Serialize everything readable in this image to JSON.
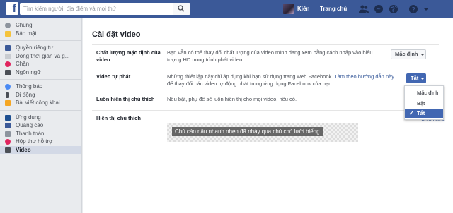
{
  "topbar": {
    "logo": "f",
    "search_placeholder": "Tìm kiếm người, địa điểm và mọi thứ",
    "user_name": "Kiên",
    "home_label": "Trang chủ"
  },
  "sidebar": {
    "groups": [
      [
        {
          "label": "Chung",
          "icon": "gear-icon",
          "color": "#8d949e"
        },
        {
          "label": "Bảo mật",
          "icon": "shield-icon",
          "color": "#f5c33b"
        }
      ],
      [
        {
          "label": "Quyền riêng tư",
          "icon": "lock-people-icon",
          "color": "#3b5998"
        },
        {
          "label": "Dòng thời gian và g...",
          "icon": "timeline-icon",
          "color": "#8d949e"
        },
        {
          "label": "Chặn",
          "icon": "block-icon",
          "color": "#e0245e"
        },
        {
          "label": "Ngôn ngữ",
          "icon": "language-icon",
          "color": "#4b4f56"
        }
      ],
      [
        {
          "label": "Thông báo",
          "icon": "globe-icon",
          "color": "#4a8af4"
        },
        {
          "label": "Di động",
          "icon": "mobile-icon",
          "color": "#4b4f56"
        },
        {
          "label": "Bài viết công khai",
          "icon": "rss-icon",
          "color": "#f5a623"
        }
      ],
      [
        {
          "label": "Ứng dụng",
          "icon": "apps-icon",
          "color": "#1d4f91"
        },
        {
          "label": "Quảng cáo",
          "icon": "ads-icon",
          "color": "#3b5998"
        },
        {
          "label": "Thanh toán",
          "icon": "card-icon",
          "color": "#8d949e"
        },
        {
          "label": "Hộp thư hỗ trợ",
          "icon": "lifebuoy-icon",
          "color": "#e0245e"
        },
        {
          "label": "Video",
          "icon": "film-icon",
          "color": "#4b4f56",
          "active": true
        }
      ]
    ]
  },
  "main": {
    "title": "Cài đặt video",
    "rows": {
      "quality": {
        "label": "Chất lượng mặc định của video",
        "desc": "Bạn vẫn có thể thay đổi chất lượng của video mình đang xem bằng cách nhấp vào biểu tượng HD trong trình phát video.",
        "dropdown": "Mặc định"
      },
      "autoplay": {
        "label": "Video tự phát",
        "desc_before": "Những thiết lập này chỉ áp dụng khi bạn sử dụng trang web Facebook. ",
        "link": "Làm theo hướng dẫn này",
        "desc_after": " để thay đổi các video tự động phát trong ứng dụng Facebook của bạn.",
        "dropdown": "Tắt"
      },
      "always_captions": {
        "label": "Luôn hiển thị chú thích",
        "desc": "Nếu bật, phụ đề sẽ luôn hiển thị cho mọi video, nếu có."
      },
      "caption_display": {
        "label": "Hiển thị chú thích",
        "sample": "Chú cáo nâu nhanh nhẹn đã nhảy qua chú chó lười biếng",
        "edit_link": "Chỉnh sửa"
      }
    },
    "autoplay_menu": {
      "options": [
        "Mặc định",
        "Bật",
        "Tắt"
      ],
      "selected": "Tắt"
    }
  }
}
